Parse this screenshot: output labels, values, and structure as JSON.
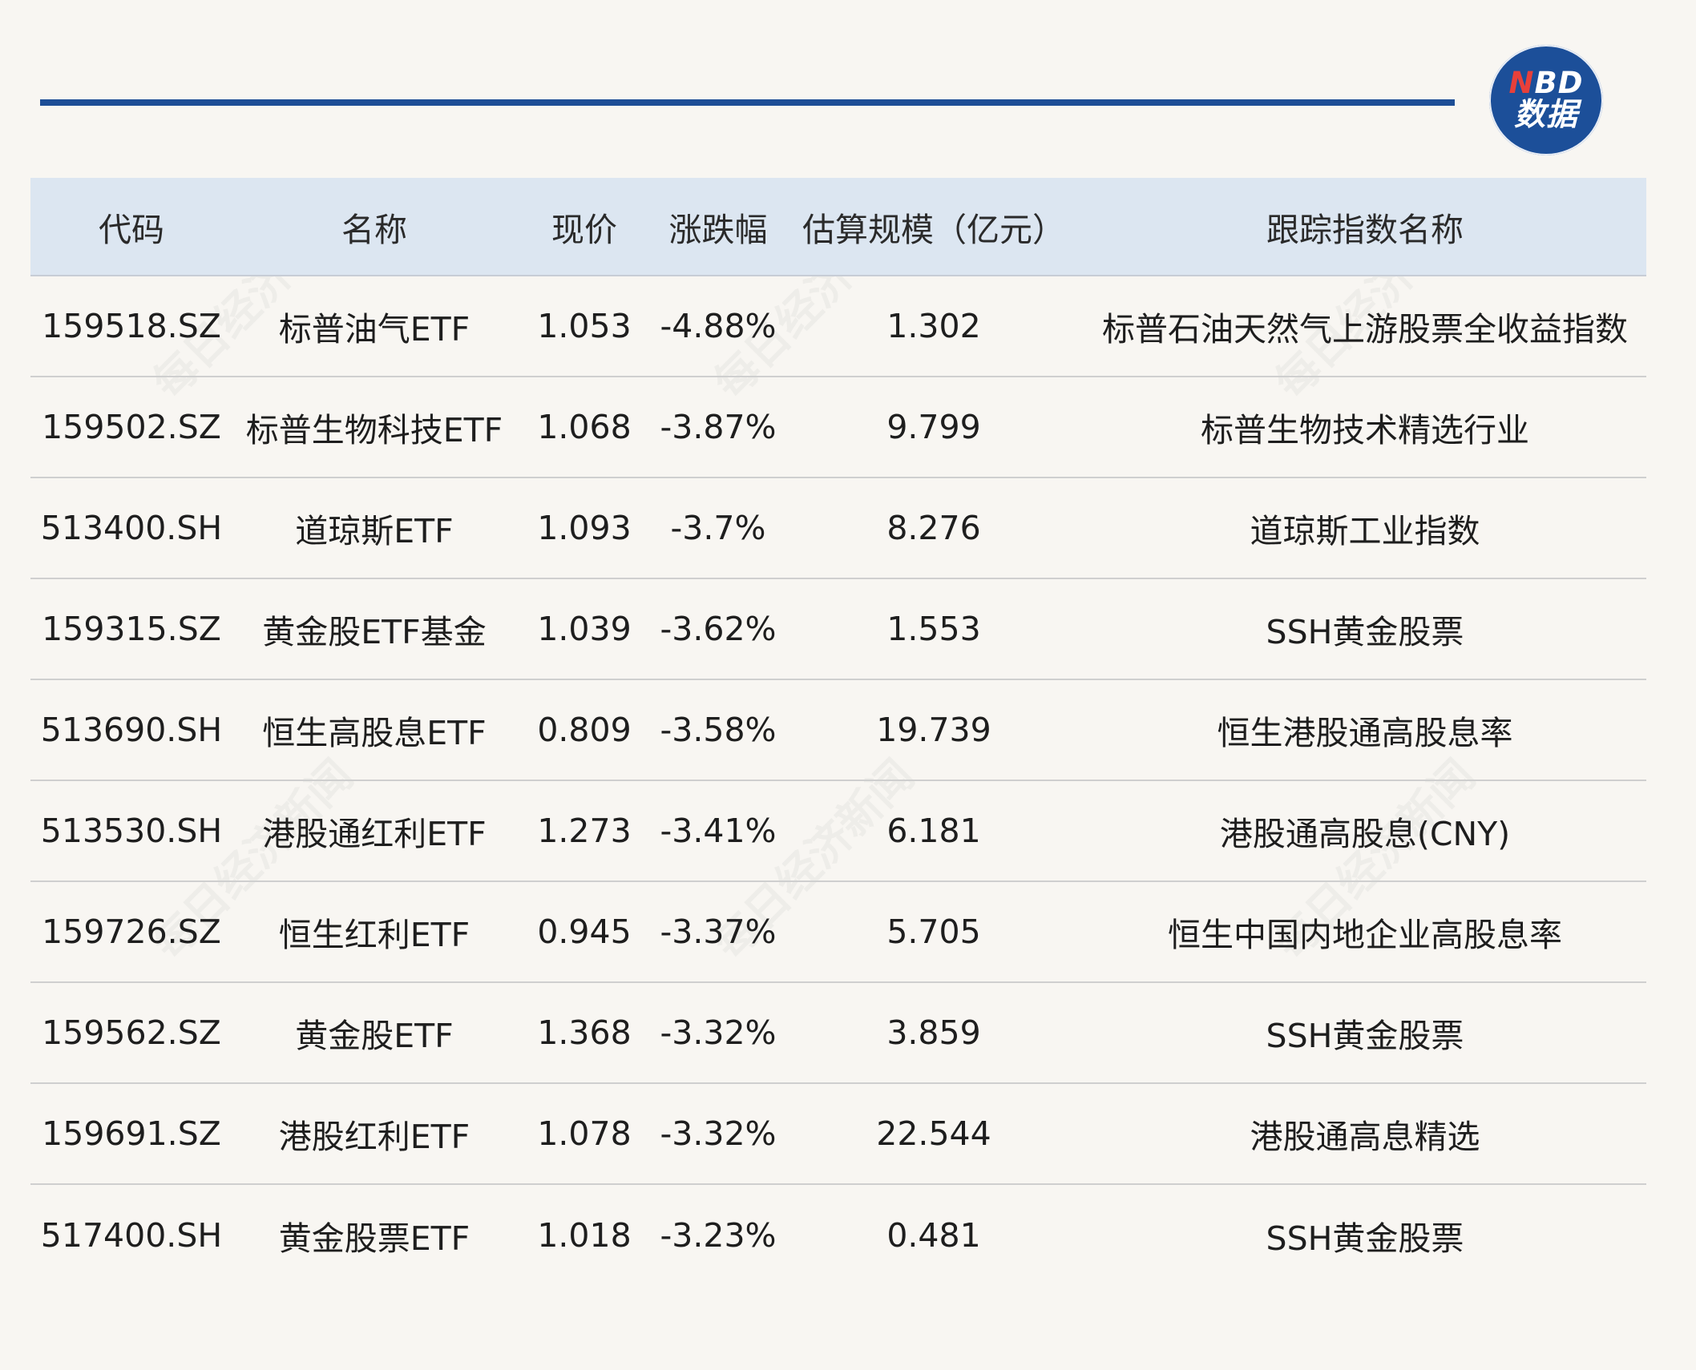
{
  "logo": {
    "top_accent": "N",
    "top_rest": "BD",
    "bottom": "数据"
  },
  "watermark": "每日经济新闻",
  "table": {
    "headers": [
      "代码",
      "名称",
      "现价",
      "涨跌幅",
      "估算规模（亿元）",
      "跟踪指数名称"
    ],
    "rows": [
      [
        "159518.SZ",
        "标普油气ETF",
        "1.053",
        "-4.88%",
        "1.302",
        "标普石油天然气上游股票全收益指数"
      ],
      [
        "159502.SZ",
        "标普生物科技ETF",
        "1.068",
        "-3.87%",
        "9.799",
        "标普生物技术精选行业"
      ],
      [
        "513400.SH",
        "道琼斯ETF",
        "1.093",
        "-3.7%",
        "8.276",
        "道琼斯工业指数"
      ],
      [
        "159315.SZ",
        "黄金股ETF基金",
        "1.039",
        "-3.62%",
        "1.553",
        "SSH黄金股票"
      ],
      [
        "513690.SH",
        "恒生高股息ETF",
        "0.809",
        "-3.58%",
        "19.739",
        "恒生港股通高股息率"
      ],
      [
        "513530.SH",
        "港股通红利ETF",
        "1.273",
        "-3.41%",
        "6.181",
        "港股通高股息(CNY)"
      ],
      [
        "159726.SZ",
        "恒生红利ETF",
        "0.945",
        "-3.37%",
        "5.705",
        "恒生中国内地企业高股息率"
      ],
      [
        "159562.SZ",
        "黄金股ETF",
        "1.368",
        "-3.32%",
        "3.859",
        "SSH黄金股票"
      ],
      [
        "159691.SZ",
        "港股红利ETF",
        "1.078",
        "-3.32%",
        "22.544",
        "港股通高息精选"
      ],
      [
        "517400.SH",
        "黄金股票ETF",
        "1.018",
        "-3.23%",
        "0.481",
        "SSH黄金股票"
      ]
    ]
  }
}
